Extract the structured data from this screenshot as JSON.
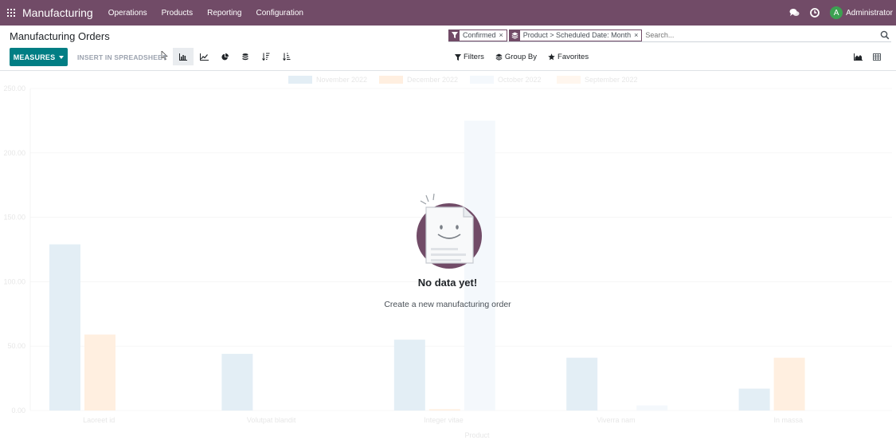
{
  "app": {
    "brand": "Manufacturing",
    "menu": [
      "Operations",
      "Products",
      "Reporting",
      "Configuration"
    ],
    "user": "Administrator",
    "user_initial": "A"
  },
  "control_panel": {
    "breadcrumb": "Manufacturing Orders",
    "measures_label": "MEASURES",
    "insert_label": "INSERT IN SPREADSHEET",
    "search": {
      "facets": [
        {
          "icon": "filter-icon",
          "values": "Confirmed"
        },
        {
          "icon": "layers-icon",
          "values": "Product > Scheduled Date: Month"
        }
      ],
      "placeholder": "Search..."
    },
    "filters_label": "Filters",
    "groupby_label": "Group By",
    "favorites_label": "Favorites"
  },
  "help": {
    "title": "No data yet!",
    "description": "Create a new manufacturing order"
  },
  "colors": {
    "primary": "#714b67",
    "accent": "#017e84",
    "avatar": "#3ca151"
  },
  "chart_data": {
    "type": "bar",
    "categories": [
      "Laoreet id",
      "Volutpat blandit",
      "Integer vitae",
      "Viverra nam",
      "In massa"
    ],
    "series": [
      {
        "name": "November 2022",
        "color": "#1f77b4",
        "values": [
          129,
          44,
          55,
          41,
          17
        ]
      },
      {
        "name": "December 2022",
        "color": "#ff7f0e",
        "values": [
          59,
          0,
          1,
          0,
          41
        ]
      },
      {
        "name": "October 2022",
        "color": "#aec7e8",
        "values": [
          0,
          0,
          225,
          4,
          0
        ]
      },
      {
        "name": "September 2022",
        "color": "#ffbb78",
        "values": [
          0,
          0,
          0,
          0,
          0
        ]
      }
    ],
    "yticks": [
      "0.00",
      "50.00",
      "100.00",
      "150.00",
      "200.00",
      "250.00"
    ],
    "ylim": [
      0,
      250
    ],
    "xlabel": "Product",
    "legend_position": "top"
  }
}
